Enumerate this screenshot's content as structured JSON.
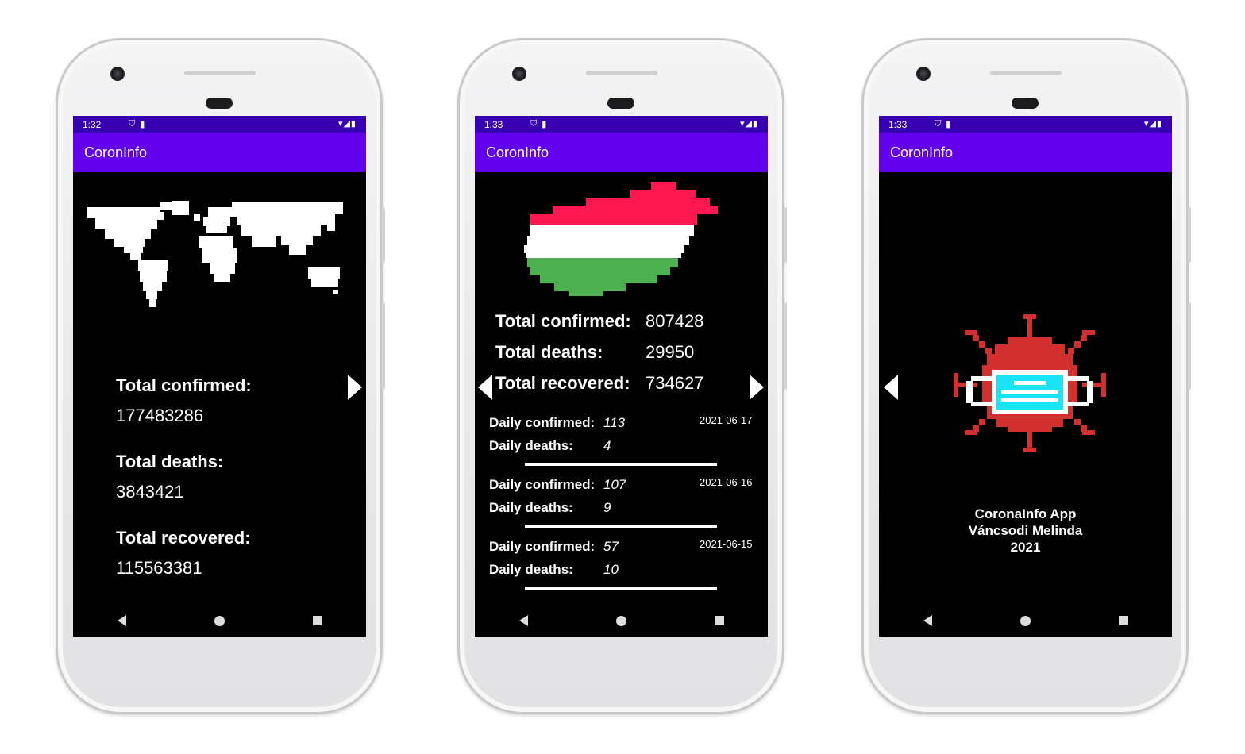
{
  "phones": [
    {
      "status": {
        "time": "1:32"
      },
      "appbar": {
        "title": "CoronInfo"
      },
      "world": {
        "total_confirmed_label": "Total confirmed:",
        "total_confirmed": "177483286",
        "total_deaths_label": "Total deaths:",
        "total_deaths": "3843421",
        "total_recovered_label": "Total recovered:",
        "total_recovered": "115563381"
      }
    },
    {
      "status": {
        "time": "1:33"
      },
      "appbar": {
        "title": "CoronInfo"
      },
      "hungary": {
        "total_confirmed_label": "Total confirmed:",
        "total_confirmed": "807428",
        "total_deaths_label": "Total deaths:",
        "total_deaths": "29950",
        "total_recovered_label": "Total recovered:",
        "total_recovered": "734627",
        "flag_colors": [
          "#ff174f",
          "#ffffff",
          "#4caf50"
        ],
        "daily": [
          {
            "confirmed_label": "Daily confirmed:",
            "confirmed": "113",
            "deaths_label": "Daily deaths:",
            "deaths": "4",
            "date": "2021-06-17"
          },
          {
            "confirmed_label": "Daily confirmed:",
            "confirmed": "107",
            "deaths_label": "Daily deaths:",
            "deaths": "9",
            "date": "2021-06-16"
          },
          {
            "confirmed_label": "Daily confirmed:",
            "confirmed": "57",
            "deaths_label": "Daily deaths:",
            "deaths": "10",
            "date": "2021-06-15"
          }
        ]
      }
    },
    {
      "status": {
        "time": "1:33"
      },
      "appbar": {
        "title": "CoronInfo"
      },
      "about": {
        "line1": "CoronaInfo App",
        "line2": "Váncsodi Melinda",
        "line3": "2021",
        "virus_color": "#d32f2f",
        "mask_color": "#18e4f5"
      }
    }
  ],
  "colors": {
    "status_bar": "#3700b3",
    "app_bar": "#6200ee",
    "background": "#000000"
  }
}
